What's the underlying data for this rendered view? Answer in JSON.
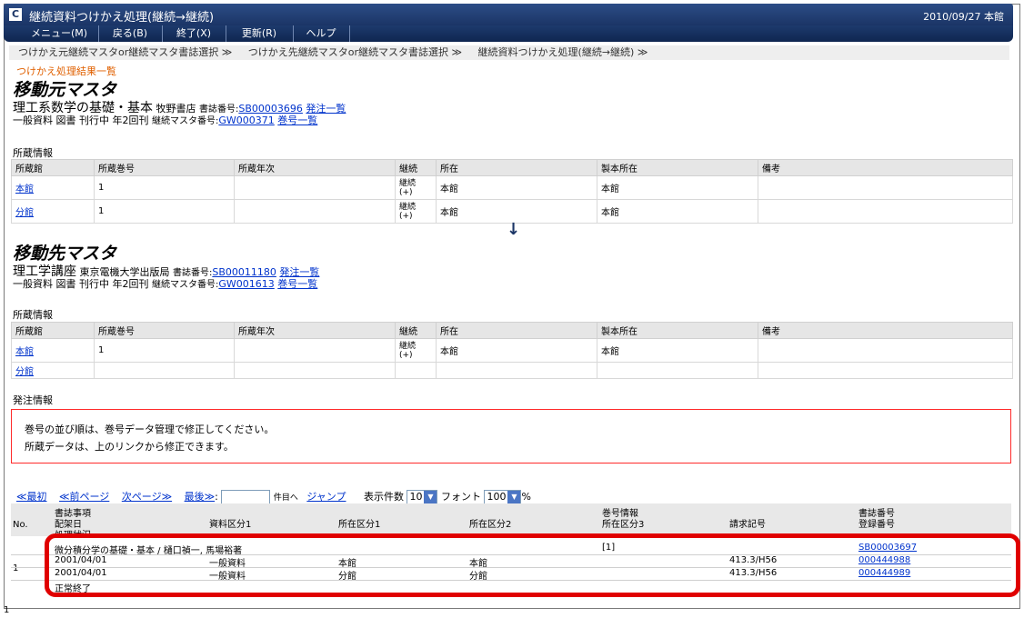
{
  "window": {
    "app_icon": "C",
    "title": "継続資料つけかえ処理(継続→継続)",
    "date": "2010/09/27",
    "library": "本館"
  },
  "menu": [
    {
      "label": "メニュー(M)"
    },
    {
      "label": "戻る(B)"
    },
    {
      "label": "終了(X)"
    },
    {
      "label": "更新(R)"
    },
    {
      "label": "ヘルプ"
    }
  ],
  "breadcrumbs": [
    "つけかえ元継続マスタor継続マスタ書誌選択 ≫",
    "つけかえ先継続マスタor継続マスタ書誌選択 ≫",
    "継続資料つけかえ処理(継続→継続) ≫"
  ],
  "result_label": "つけかえ処理結果一覧",
  "source": {
    "heading": "移動元マスタ",
    "title": "理工系数学の基礎・基本",
    "publisher": "牧野書店",
    "bib_label": "書誌番号:",
    "bib_no": "SB00003696",
    "order_link": "発注一覧",
    "meta": "一般資料 図書 刊行中 年2回刊",
    "master_label": "継続マスタ番号:",
    "master_no": "GW000371",
    "volume_link": "巻号一覧",
    "holdings_label": "所蔵情報",
    "rows": [
      {
        "library": "本館",
        "vol": "1",
        "year": "",
        "cont1": "継続",
        "cont2": "(+)",
        "loc": "本館",
        "bind_loc": "本館",
        "note": ""
      },
      {
        "library": "分館",
        "vol": "1",
        "year": "",
        "cont1": "継続",
        "cont2": "(+)",
        "loc": "本館",
        "bind_loc": "本館",
        "note": ""
      }
    ]
  },
  "holdings_headers": {
    "library": "所蔵館",
    "vol": "所蔵巻号",
    "year": "所蔵年次",
    "cont": "継続",
    "loc": "所在",
    "bind_loc": "製本所在",
    "note": "備考"
  },
  "arrow": "↓",
  "target": {
    "heading": "移動先マスタ",
    "title": "理工学講座",
    "publisher": "東京電機大学出版局",
    "bib_label": "書誌番号:",
    "bib_no": "SB00011180",
    "order_link": "発注一覧",
    "meta": "一般資料 図書 刊行中 年2回刊",
    "master_label": "継続マスタ番号:",
    "master_no": "GW001613",
    "volume_link": "巻号一覧",
    "holdings_label": "所蔵情報",
    "rows": [
      {
        "library": "本館",
        "vol": "1",
        "year": "",
        "cont1": "継続",
        "cont2": "(+)",
        "loc": "本館",
        "bind_loc": "本館",
        "note": ""
      },
      {
        "library": "分館",
        "vol": "",
        "year": "",
        "cont1": "",
        "cont2": "",
        "loc": "",
        "bind_loc": "",
        "note": ""
      }
    ]
  },
  "order_label": "発注情報",
  "messages": {
    "line1": "巻号の並び順は、巻号データ管理で修正してください。",
    "line2": "所蔵データは、上のリンクから修正できます。"
  },
  "pager": {
    "first": "≪最初",
    "prev": "≪前ページ",
    "next": "次ページ≫",
    "last": "最後≫",
    "colon": ":",
    "page_suffix": "件目へ",
    "jump": "ジャンプ",
    "count_label": "表示件数",
    "count_value": "10",
    "font_label": "フォント",
    "font_value": "100",
    "percent": "%"
  },
  "results": {
    "headers": {
      "no": "No.",
      "bib_items": "書誌事項",
      "arrival": "配架日",
      "status_partial": "処理状況",
      "type": "資料区分1",
      "loc1": "所在区分1",
      "loc2": "所在区分2",
      "vol_info": "巻号情報",
      "loc3": "所在区分3",
      "call_no": "請求記号",
      "bib_no": "書誌番号",
      "reg_no": "登録番号"
    },
    "rows": [
      {
        "no": "1",
        "title": "微分積分学の基礎・基本 / 樋口禎一, 馬場裕著",
        "vol": "[1]",
        "bib_no": "SB00003697",
        "items": [
          {
            "date": "2001/04/01",
            "type": "一般資料",
            "loc1": "本館",
            "loc2": "本館",
            "call": "413.3/H56",
            "reg": "000444988"
          },
          {
            "date": "2001/04/01",
            "type": "一般資料",
            "loc1": "分館",
            "loc2": "分館",
            "call": "413.3/H56",
            "reg": "000444989"
          }
        ],
        "status": "正常終了"
      }
    ]
  },
  "page_number": "1",
  "colors": {
    "accent": "#1b3566",
    "link": "#0033cc",
    "alert_border": "#ff2a2a",
    "highlight": "#e00000",
    "orange": "#e06000"
  }
}
